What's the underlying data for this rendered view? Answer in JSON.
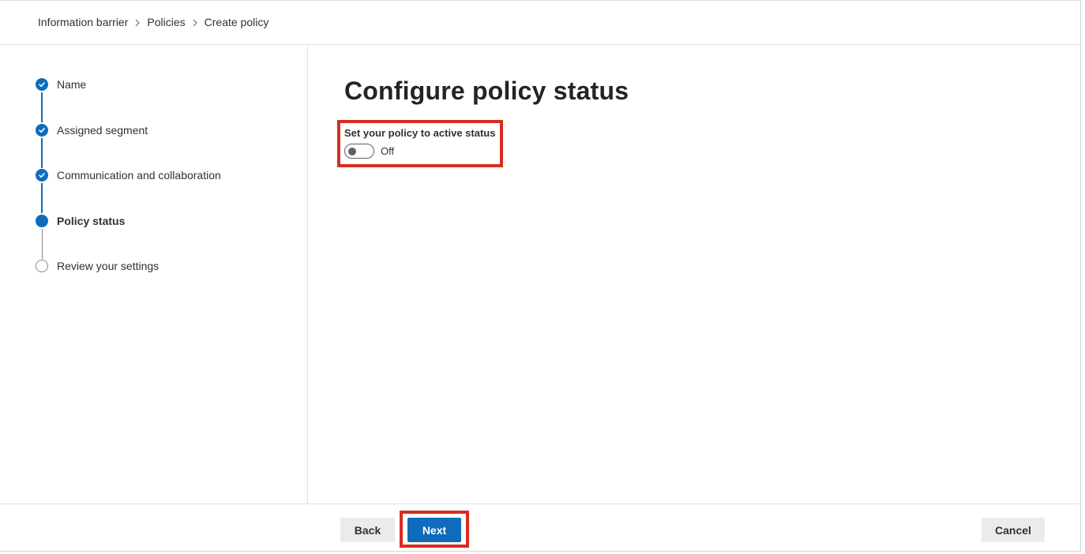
{
  "breadcrumb": {
    "items": [
      "Information barrier",
      "Policies",
      "Create policy"
    ]
  },
  "steps": [
    {
      "label": "Name",
      "status": "done"
    },
    {
      "label": "Assigned segment",
      "status": "done"
    },
    {
      "label": "Communication and collaboration",
      "status": "done"
    },
    {
      "label": "Policy status",
      "status": "current"
    },
    {
      "label": "Review your settings",
      "status": "pending"
    }
  ],
  "main": {
    "title": "Configure policy status",
    "toggle_label": "Set your policy to active status",
    "toggle_state": "Off",
    "toggle_on": false
  },
  "footer": {
    "back_label": "Back",
    "next_label": "Next",
    "cancel_label": "Cancel"
  },
  "colors": {
    "accent": "#0f6cbd",
    "highlight": "#d62d20"
  }
}
